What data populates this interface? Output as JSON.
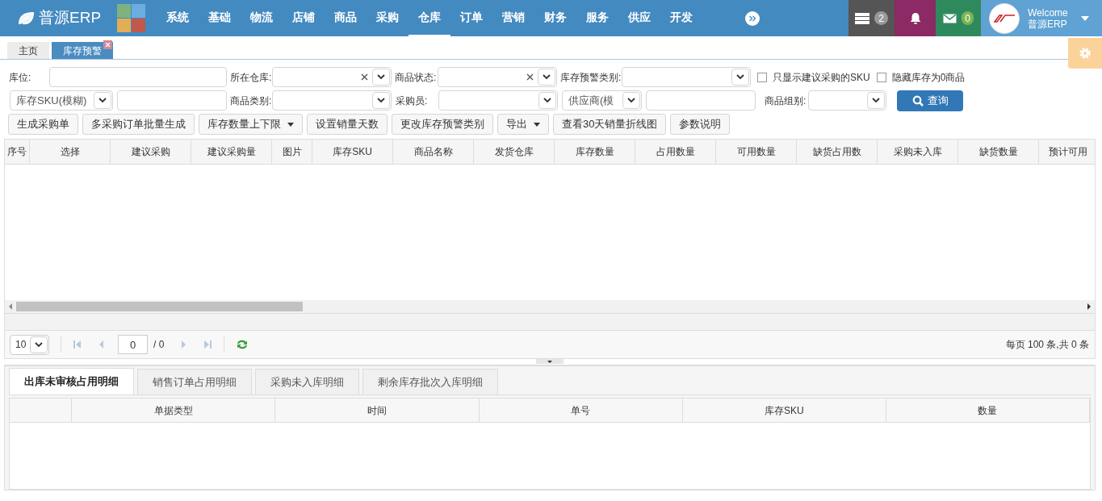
{
  "header": {
    "logo": "普源ERP",
    "nav": [
      {
        "label": "系统",
        "selected": false
      },
      {
        "label": "基础",
        "selected": false
      },
      {
        "label": "物流",
        "selected": false
      },
      {
        "label": "店铺",
        "selected": false
      },
      {
        "label": "商品",
        "selected": false
      },
      {
        "label": "采购",
        "selected": false
      },
      {
        "label": "仓库",
        "selected": true
      },
      {
        "label": "订单",
        "selected": false
      },
      {
        "label": "营销",
        "selected": false
      },
      {
        "label": "财务",
        "selected": false
      },
      {
        "label": "服务",
        "selected": false
      },
      {
        "label": "供应",
        "selected": false
      },
      {
        "label": "开发",
        "selected": false
      }
    ],
    "task_count": "2",
    "mail_count": "0",
    "user": {
      "greeting": "Welcome",
      "name": "普源ERP"
    }
  },
  "page_tabs": [
    {
      "label": "主页",
      "selected": false,
      "closable": false
    },
    {
      "label": "库存预警",
      "selected": true,
      "closable": true
    }
  ],
  "filter_row_1": [
    {
      "kind": "text",
      "label": "库位:"
    },
    {
      "kind": "select",
      "label": "所在仓库:",
      "clearable": true
    },
    {
      "kind": "select",
      "label": "商品状态:",
      "clearable": true
    },
    {
      "kind": "select",
      "label": "库存预警类别:",
      "clearable": false
    },
    {
      "kind": "checkbox",
      "label": "只显示建议采购的SKU",
      "checked": false
    },
    {
      "kind": "checkbox",
      "label": "隐藏库存为0商品",
      "checked": false
    }
  ],
  "filter_row_2": [
    {
      "kind": "select",
      "value": "库存SKU(模糊)"
    },
    {
      "kind": "text"
    },
    {
      "kind": "select",
      "label": "商品类别:"
    },
    {
      "kind": "select",
      "label": "采购员:"
    },
    {
      "kind": "select",
      "value": "供应商(模"
    },
    {
      "kind": "text"
    },
    {
      "kind": "select",
      "label": "商品组别:"
    },
    {
      "kind": "button",
      "label": "查询"
    }
  ],
  "toolbar": [
    {
      "label": "生成采购单",
      "dropdown": false
    },
    {
      "label": "多采购订单批量生成",
      "dropdown": false
    },
    {
      "label": "库存数量上下限",
      "dropdown": true
    },
    {
      "label": "设置销量天数",
      "dropdown": false
    },
    {
      "label": "更改库存预警类别",
      "dropdown": false
    },
    {
      "label": "导出",
      "dropdown": true
    },
    {
      "label": "查看30天销量折线图",
      "dropdown": false
    },
    {
      "label": "参数说明",
      "dropdown": false
    }
  ],
  "table": {
    "columns": [
      "序号",
      "选择",
      "建议采购",
      "建议采购量",
      "图片",
      "库存SKU",
      "商品名称",
      "发货仓库",
      "库存数量",
      "占用数量",
      "可用数量",
      "缺货占用数",
      "采购未入库",
      "缺货数量",
      "预计可用"
    ]
  },
  "pager": {
    "page_size": "10",
    "page": "0",
    "total_pages": "/ 0",
    "summary": "每页 100 条,共 0 条"
  },
  "detail_tabs": [
    {
      "label": "出库未审核占用明细",
      "selected": true
    },
    {
      "label": "销售订单占用明细",
      "selected": false
    },
    {
      "label": "采购未入库明细",
      "selected": false
    },
    {
      "label": "剩余库存批次入库明细",
      "selected": false
    }
  ],
  "detail_table": {
    "columns": [
      "单据类型",
      "时间",
      "单号",
      "库存SKU",
      "数量"
    ]
  }
}
